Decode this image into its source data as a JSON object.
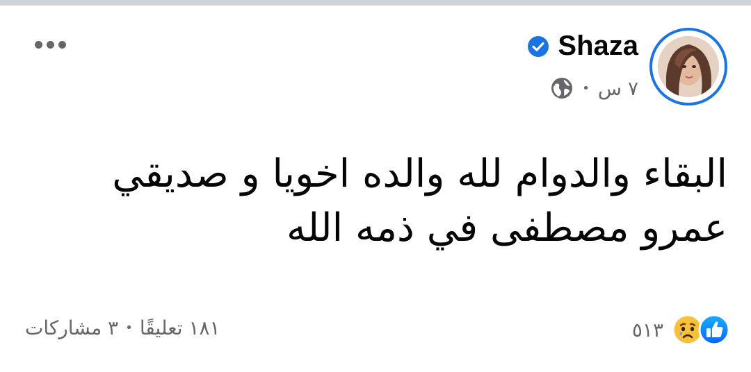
{
  "post": {
    "author": "Shaza",
    "verified": true,
    "time": "٧ س",
    "separator": "•",
    "audience_icon": "globe-icon",
    "text": "البقاء والدوام لله والده اخويا و صديقي عمرو مصطفى في ذمه الله"
  },
  "reactions": {
    "icons": [
      "like-icon",
      "sad-icon"
    ],
    "count": "٥١٣"
  },
  "engagement": {
    "comments": "١٨١ تعليقًا",
    "separator": "•",
    "shares": "٣ مشاركات"
  },
  "colors": {
    "accent": "#1b74e4",
    "secondary_text": "#65676b",
    "primary_text": "#050505",
    "top_strip": "#cfd2d6"
  }
}
